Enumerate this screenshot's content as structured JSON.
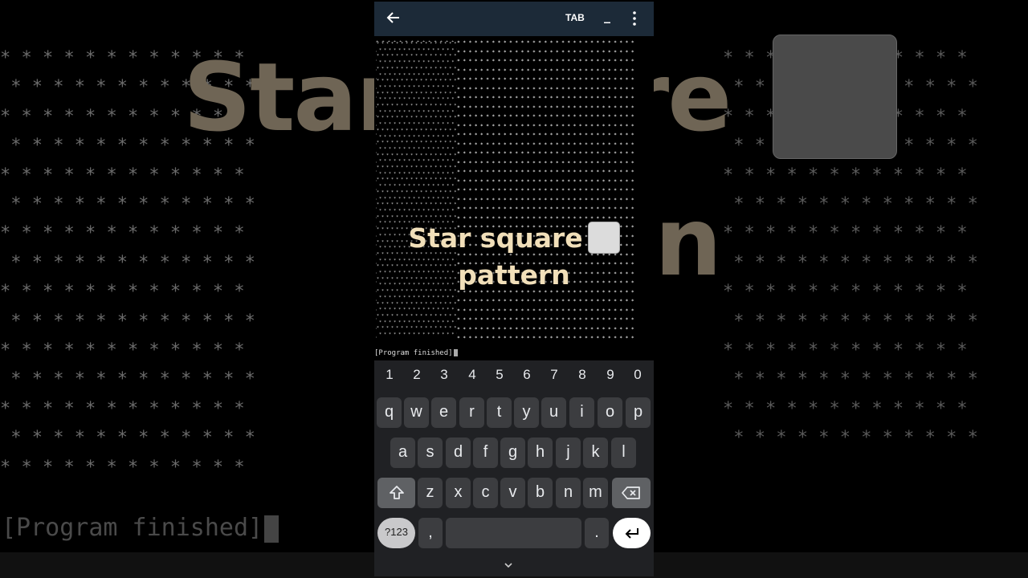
{
  "topbar": {
    "back_icon": "arrow-left-icon",
    "tab_label": "TAB",
    "minimize_label": "_",
    "more_icon": "more-vertical-icon"
  },
  "overlay": {
    "title_line1": "Star square",
    "title_line2": "pattern",
    "square_icon": "white-square-emoji"
  },
  "background": {
    "title_left": "Star",
    "title_right": "re",
    "title_second": "n",
    "program_text": "[Program finished]"
  },
  "terminal": {
    "program_text": "[Program finished]"
  },
  "keyboard": {
    "numbers": [
      "1",
      "2",
      "3",
      "4",
      "5",
      "6",
      "7",
      "8",
      "9",
      "0"
    ],
    "row1": [
      "q",
      "w",
      "e",
      "r",
      "t",
      "y",
      "u",
      "i",
      "o",
      "p"
    ],
    "row2": [
      "a",
      "s",
      "d",
      "f",
      "g",
      "h",
      "j",
      "k",
      "l"
    ],
    "row3": [
      "z",
      "x",
      "c",
      "v",
      "b",
      "n",
      "m"
    ],
    "symbols_label": "?123",
    "comma_label": ",",
    "period_label": ".",
    "enter_icon": "enter-icon",
    "shift_icon": "shift-icon",
    "backspace_icon": "backspace-icon",
    "hide_icon": "chevron-down-icon"
  },
  "colors": {
    "topbar": "#1c2a38",
    "title": "#f1dfb9",
    "keyboard": "#202124",
    "key": "#3c3d40"
  }
}
